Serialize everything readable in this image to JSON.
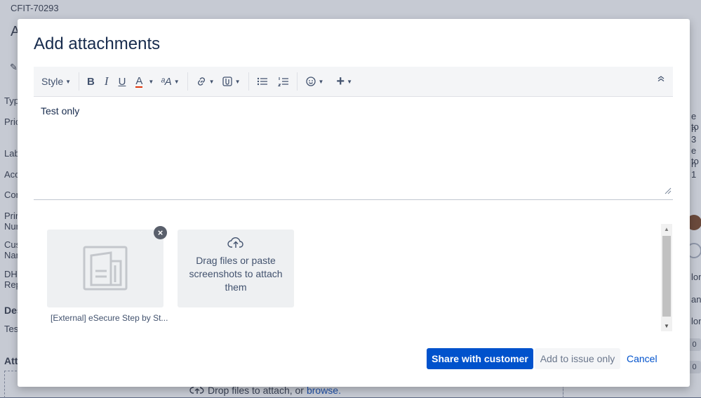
{
  "background": {
    "issue_key": "CFIT-70293",
    "left_labels": [
      "A",
      "Typ",
      "Pric",
      "Lab",
      "Acc",
      "Cor",
      "Prir",
      "Nur",
      "Cus",
      "Nar",
      "DH",
      "Rep",
      "Des",
      "Test",
      "Att"
    ],
    "right_fragments": [
      "e to",
      "n 3",
      "e to",
      "n 1",
      "lon",
      "an",
      "lon"
    ],
    "counts": [
      "0",
      "0"
    ],
    "dropzone_text": "Drop files to attach, or",
    "dropzone_link": "browse."
  },
  "modal": {
    "title": "Add attachments",
    "toolbar": {
      "style_label": "Style",
      "bold_label": "B",
      "italic_label": "I",
      "underline_label": "U",
      "text_color_label": "A",
      "more_format_label": "ᵃA"
    },
    "editor_content": "Test only",
    "attachments": [
      {
        "name": "[External] eSecure Step by St..."
      }
    ],
    "dropzone_text": "Drag files or paste screenshots to attach them",
    "buttons": {
      "primary": "Share with customer",
      "secondary": "Add to issue only",
      "cancel": "Cancel"
    },
    "colors": {
      "primary": "#0052cc",
      "title": "#172b4d"
    }
  }
}
